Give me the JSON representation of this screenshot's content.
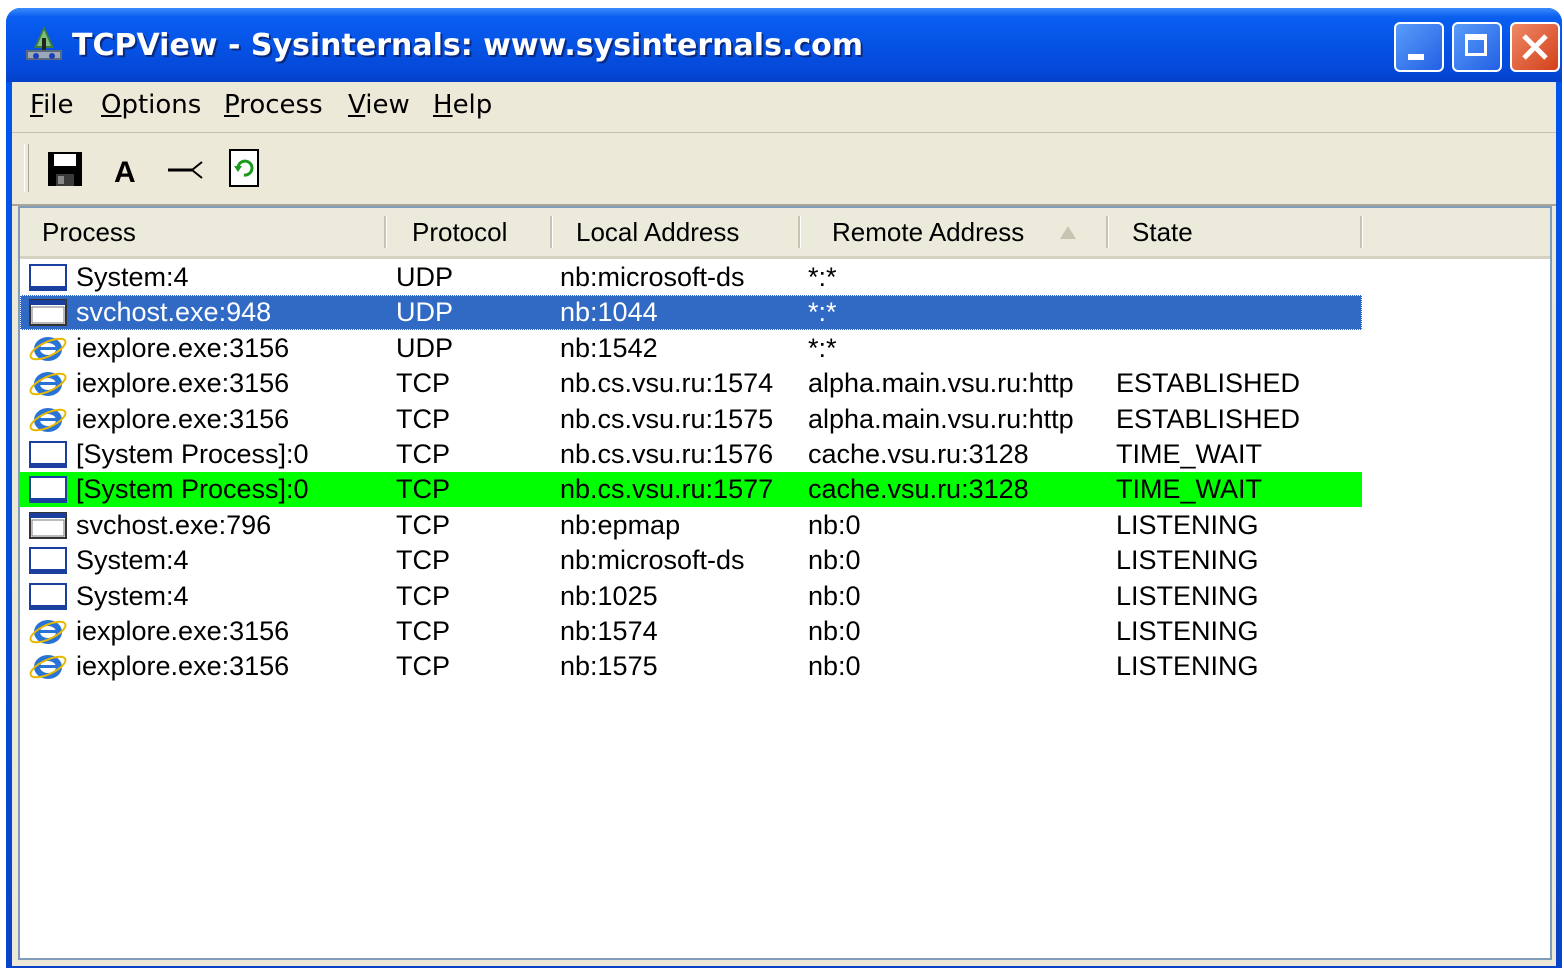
{
  "window": {
    "title": "TCPView - Sysinternals: www.sysinternals.com",
    "icon": "network-computer-icon",
    "buttons": [
      "minimize-icon",
      "maximize-icon",
      "close-icon"
    ]
  },
  "menu": {
    "file": "File",
    "options": "Options",
    "process": "Process",
    "view": "View",
    "help": "Help"
  },
  "toolbar": {
    "tools": [
      "save-icon",
      "font-icon",
      "resolve-addresses-icon",
      "refresh-icon"
    ]
  },
  "list": {
    "headers": {
      "process": "Process",
      "protocol": "Protocol",
      "local": "Local Address",
      "remote": "Remote Address",
      "state": "State"
    },
    "sort_column": "Remote Address",
    "rows": [
      {
        "icon": "window-app-icon",
        "process": "System:4",
        "protocol": "UDP",
        "local": "nb:microsoft-ds",
        "remote": "*:*",
        "state": "",
        "style": "normal"
      },
      {
        "icon": "service-window-icon",
        "process": "svchost.exe:948",
        "protocol": "UDP",
        "local": "nb:1044",
        "remote": "*:*",
        "state": "",
        "style": "selected"
      },
      {
        "icon": "internet-explorer-icon",
        "process": "iexplore.exe:3156",
        "protocol": "UDP",
        "local": "nb:1542",
        "remote": "*:*",
        "state": "",
        "style": "normal"
      },
      {
        "icon": "internet-explorer-icon",
        "process": "iexplore.exe:3156",
        "protocol": "TCP",
        "local": "nb.cs.vsu.ru:1574",
        "remote": "alpha.main.vsu.ru:http",
        "state": "ESTABLISHED",
        "style": "normal"
      },
      {
        "icon": "internet-explorer-icon",
        "process": "iexplore.exe:3156",
        "protocol": "TCP",
        "local": "nb.cs.vsu.ru:1575",
        "remote": "alpha.main.vsu.ru:http",
        "state": "ESTABLISHED",
        "style": "normal"
      },
      {
        "icon": "window-app-icon",
        "process": "[System Process]:0",
        "protocol": "TCP",
        "local": "nb.cs.vsu.ru:1576",
        "remote": "cache.vsu.ru:3128",
        "state": "TIME_WAIT",
        "style": "normal"
      },
      {
        "icon": "window-app-icon",
        "process": "[System Process]:0",
        "protocol": "TCP",
        "local": "nb.cs.vsu.ru:1577",
        "remote": "cache.vsu.ru:3128",
        "state": "TIME_WAIT",
        "style": "green"
      },
      {
        "icon": "service-window-icon",
        "process": "svchost.exe:796",
        "protocol": "TCP",
        "local": "nb:epmap",
        "remote": "nb:0",
        "state": "LISTENING",
        "style": "normal"
      },
      {
        "icon": "window-app-icon",
        "process": "System:4",
        "protocol": "TCP",
        "local": "nb:microsoft-ds",
        "remote": "nb:0",
        "state": "LISTENING",
        "style": "normal"
      },
      {
        "icon": "window-app-icon",
        "process": "System:4",
        "protocol": "TCP",
        "local": "nb:1025",
        "remote": "nb:0",
        "state": "LISTENING",
        "style": "normal"
      },
      {
        "icon": "internet-explorer-icon",
        "process": "iexplore.exe:3156",
        "protocol": "TCP",
        "local": "nb:1574",
        "remote": "nb:0",
        "state": "LISTENING",
        "style": "normal"
      },
      {
        "icon": "internet-explorer-icon",
        "process": "iexplore.exe:3156",
        "protocol": "TCP",
        "local": "nb:1575",
        "remote": "nb:0",
        "state": "LISTENING",
        "style": "normal"
      }
    ]
  },
  "colors": {
    "selected_row": "#316ac5",
    "highlight_row": "#00ff00"
  }
}
